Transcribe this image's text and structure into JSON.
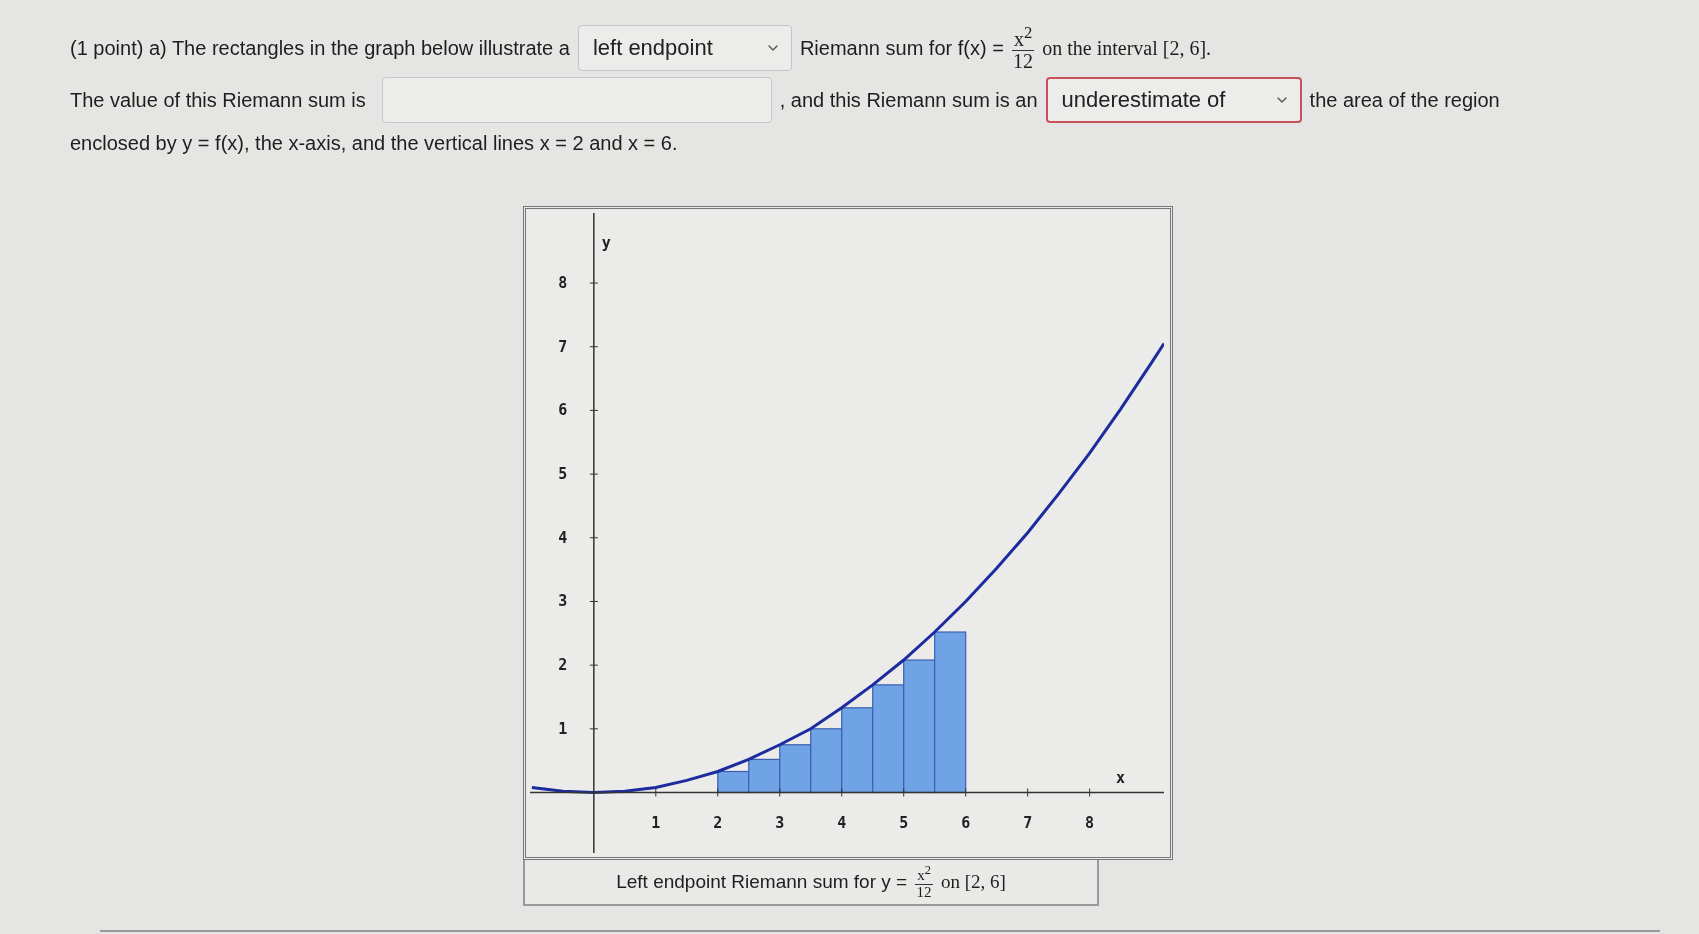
{
  "question": {
    "points": "(1 point) a) The rectangles in the graph below illustrate a",
    "method_select": {
      "value": "left endpoint",
      "highlighted": false
    },
    "text_after_method": "Riemann sum for f(x) =",
    "fraction": {
      "numerator": "x$^{2}$",
      "denominator": "12"
    },
    "interval_text": "on the interval [2, 6].",
    "value_label": "The value of this Riemann sum is",
    "estimate_label": ", and this Riemann sum is an",
    "estimate_select": {
      "value": "underestimate of",
      "highlighted": true
    },
    "region_text": "the area of the region",
    "enclosed_text": "enclosed by y = f(x), the x-axis, and the vertical lines x = 2 and x = 6."
  },
  "graph": {
    "caption": {
      "before": "Left endpoint Riemann sum for y =",
      "numerator": "x$^{2}$",
      "denominator": "12",
      "after": "on [2, 6]"
    },
    "chart_data": {
      "type": "bar",
      "xlabel": "x",
      "ylabel": "y",
      "x": [
        2.25,
        2.75,
        3.25,
        3.75,
        4.25,
        4.75,
        5.25,
        5.75
      ],
      "series": [
        {
          "color": "#6fa3e6",
          "values": [
            0.33,
            0.52,
            0.75,
            1.0,
            1.33,
            1.69,
            2.08,
            2.52
          ]
        },
        {
          "type": "line",
          "color": "#1c2b9e",
          "x": [
            -1,
            -0.5,
            0,
            0.5,
            1,
            1.5,
            2,
            2.5,
            3,
            3.5,
            4,
            4.5,
            5,
            5.5,
            6,
            6.5,
            7,
            7.5,
            8,
            8.5,
            9,
            9.2
          ],
          "values": [
            0.08,
            0.02,
            0,
            0.02,
            0.08,
            0.19,
            0.33,
            0.52,
            0.75,
            1.0,
            1.33,
            1.69,
            2.08,
            2.52,
            3.0,
            3.52,
            4.08,
            4.69,
            5.33,
            6.02,
            6.75,
            7.05
          ]
        }
      ],
      "xlim": [
        -1.03,
        9.2
      ],
      "ylim": [
        -0.95,
        9.1
      ],
      "xticks": [
        1,
        2,
        3,
        4,
        5,
        6,
        7,
        8
      ],
      "yticks": [
        1,
        2,
        3,
        4,
        5,
        6,
        7,
        8
      ]
    }
  }
}
